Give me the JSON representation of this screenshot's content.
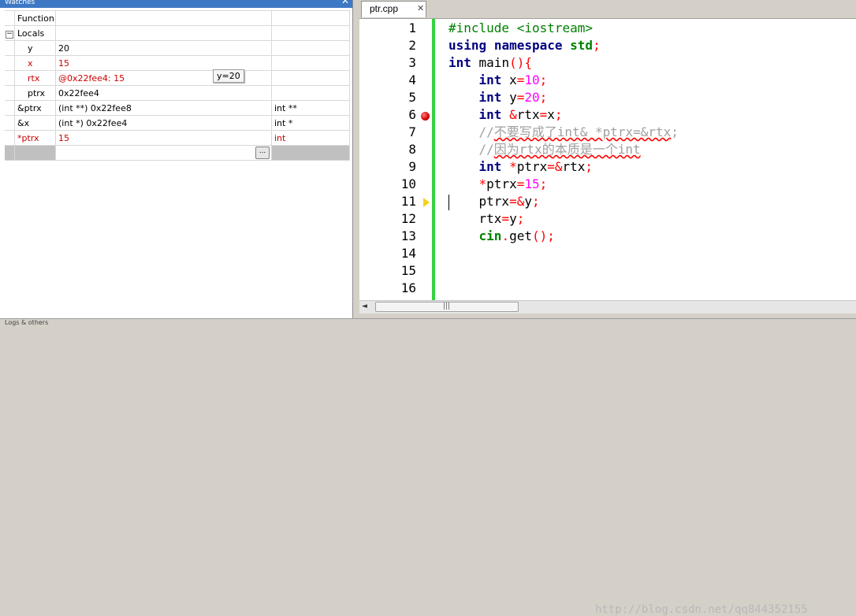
{
  "watches": {
    "title": "Watches",
    "close_glyph": "✕",
    "rows": [
      {
        "expander": "",
        "name": "Function",
        "value": "",
        "type": ""
      },
      {
        "expander": "−",
        "name": "Locals",
        "value": "",
        "type": ""
      },
      {
        "expander": "",
        "name": "y",
        "value": "20",
        "type": ""
      },
      {
        "expander": "",
        "name": "x",
        "value": "15",
        "type": ""
      },
      {
        "expander": "",
        "name": "rtx",
        "value": "@0x22fee4: 15",
        "type": ""
      },
      {
        "expander": "",
        "name": "ptrx",
        "value": "0x22fee4",
        "type": ""
      },
      {
        "expander": "",
        "name": "&ptrx",
        "value": "(int **) 0x22fee8",
        "type": "int **"
      },
      {
        "expander": "",
        "name": "&x",
        "value": "(int *) 0x22fee4",
        "type": "int *"
      },
      {
        "expander": "",
        "name": "*ptrx",
        "value": "15",
        "type": "int"
      }
    ],
    "more_button": "...",
    "tooltip": "y=20"
  },
  "editor": {
    "tab_label": "ptr.cpp",
    "tab_close": "✕",
    "line_numbers": [
      "1",
      "2",
      "3",
      "4",
      "5",
      "6",
      "7",
      "8",
      "9",
      "10",
      "11",
      "12",
      "13",
      "14",
      "15",
      "16"
    ],
    "scrollbar_grip": "|||",
    "scroll_left": "◄",
    "watermark": "http://blog.csdn.net/qq844352155"
  },
  "status": {
    "text": "Logs & others"
  },
  "colors": {
    "keyword": "#000080",
    "preprocessor": "#008000",
    "number": "#ff00ff",
    "operator": "#ff0000",
    "comment": "#a0a0a0",
    "change_bar": "#36d140",
    "breakpoint": "#d40000",
    "exec_marker": "#f2d21b",
    "changed_value": "#cc0000"
  }
}
